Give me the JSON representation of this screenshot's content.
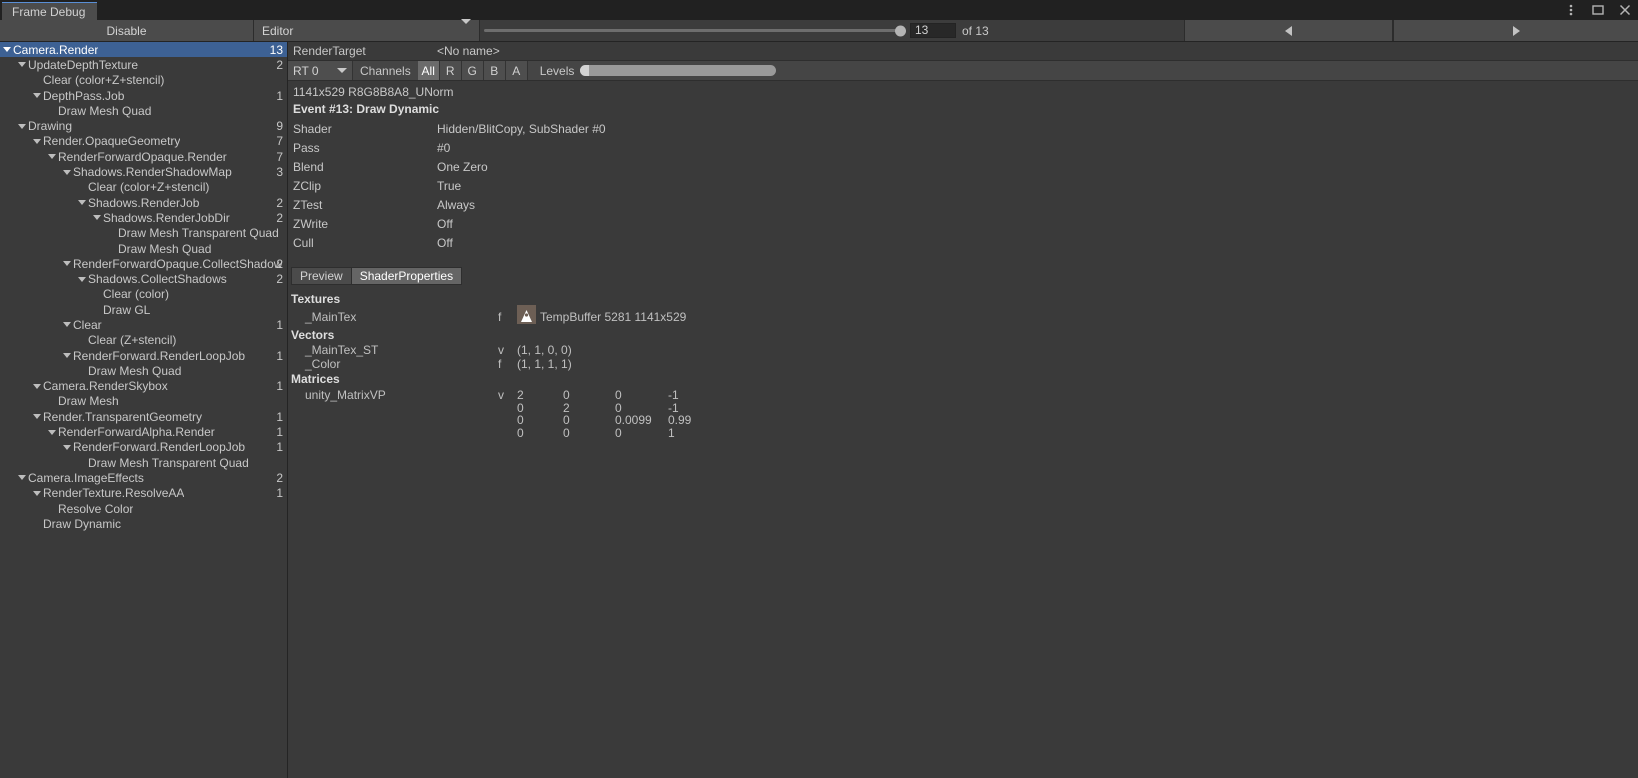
{
  "window": {
    "tab_title": "Frame Debug",
    "controls": [
      {
        "name": "kebab-menu",
        "icon": "kebab-icon"
      },
      {
        "name": "maximize",
        "icon": "maximize-icon"
      },
      {
        "name": "close",
        "icon": "close-icon"
      }
    ]
  },
  "toolbar": {
    "disable_label": "Disable",
    "target_dropdown_value": "Editor",
    "event_index_value": "13",
    "event_total_label": "of 13",
    "prev_icon": "triangle-left-icon",
    "next_icon": "triangle-right-icon"
  },
  "tree": {
    "rows": [
      {
        "label": "Camera.Render",
        "count": "13",
        "depth": 0,
        "foldout": true,
        "selected": true
      },
      {
        "label": "UpdateDepthTexture",
        "count": "2",
        "depth": 1,
        "foldout": true,
        "selected": false
      },
      {
        "label": "Clear (color+Z+stencil)",
        "count": "",
        "depth": 2,
        "foldout": false,
        "selected": false
      },
      {
        "label": "DepthPass.Job",
        "count": "1",
        "depth": 2,
        "foldout": true,
        "selected": false
      },
      {
        "label": "Draw Mesh Quad",
        "count": "",
        "depth": 3,
        "foldout": false,
        "selected": false
      },
      {
        "label": "Drawing",
        "count": "9",
        "depth": 1,
        "foldout": true,
        "selected": false
      },
      {
        "label": "Render.OpaqueGeometry",
        "count": "7",
        "depth": 2,
        "foldout": true,
        "selected": false
      },
      {
        "label": "RenderForwardOpaque.Render",
        "count": "7",
        "depth": 3,
        "foldout": true,
        "selected": false
      },
      {
        "label": "Shadows.RenderShadowMap",
        "count": "3",
        "depth": 4,
        "foldout": true,
        "selected": false
      },
      {
        "label": "Clear (color+Z+stencil)",
        "count": "",
        "depth": 5,
        "foldout": false,
        "selected": false
      },
      {
        "label": "Shadows.RenderJob",
        "count": "2",
        "depth": 5,
        "foldout": true,
        "selected": false
      },
      {
        "label": "Shadows.RenderJobDir",
        "count": "2",
        "depth": 6,
        "foldout": true,
        "selected": false
      },
      {
        "label": "Draw Mesh Transparent Quad",
        "count": "",
        "depth": 7,
        "foldout": false,
        "selected": false
      },
      {
        "label": "Draw Mesh Quad",
        "count": "",
        "depth": 7,
        "foldout": false,
        "selected": false
      },
      {
        "label": "RenderForwardOpaque.CollectShadow",
        "count": "2",
        "depth": 4,
        "foldout": true,
        "selected": false
      },
      {
        "label": "Shadows.CollectShadows",
        "count": "2",
        "depth": 5,
        "foldout": true,
        "selected": false
      },
      {
        "label": "Clear (color)",
        "count": "",
        "depth": 6,
        "foldout": false,
        "selected": false
      },
      {
        "label": "Draw GL",
        "count": "",
        "depth": 6,
        "foldout": false,
        "selected": false
      },
      {
        "label": "Clear",
        "count": "1",
        "depth": 4,
        "foldout": true,
        "selected": false
      },
      {
        "label": "Clear (Z+stencil)",
        "count": "",
        "depth": 5,
        "foldout": false,
        "selected": false
      },
      {
        "label": "RenderForward.RenderLoopJob",
        "count": "1",
        "depth": 4,
        "foldout": true,
        "selected": false
      },
      {
        "label": "Draw Mesh Quad",
        "count": "",
        "depth": 5,
        "foldout": false,
        "selected": false
      },
      {
        "label": "Camera.RenderSkybox",
        "count": "1",
        "depth": 2,
        "foldout": true,
        "selected": false
      },
      {
        "label": "Draw Mesh",
        "count": "",
        "depth": 3,
        "foldout": false,
        "selected": false
      },
      {
        "label": "Render.TransparentGeometry",
        "count": "1",
        "depth": 2,
        "foldout": true,
        "selected": false
      },
      {
        "label": "RenderForwardAlpha.Render",
        "count": "1",
        "depth": 3,
        "foldout": true,
        "selected": false
      },
      {
        "label": "RenderForward.RenderLoopJob",
        "count": "1",
        "depth": 4,
        "foldout": true,
        "selected": false
      },
      {
        "label": "Draw Mesh Transparent Quad",
        "count": "",
        "depth": 5,
        "foldout": false,
        "selected": false
      },
      {
        "label": "Camera.ImageEffects",
        "count": "2",
        "depth": 1,
        "foldout": true,
        "selected": false
      },
      {
        "label": "RenderTexture.ResolveAA",
        "count": "1",
        "depth": 2,
        "foldout": true,
        "selected": false
      },
      {
        "label": "Resolve Color",
        "count": "",
        "depth": 3,
        "foldout": false,
        "selected": false
      },
      {
        "label": "Draw Dynamic",
        "count": "",
        "depth": 2,
        "foldout": false,
        "selected": false
      }
    ]
  },
  "detail": {
    "render_target_label": "RenderTarget",
    "render_target_name": "<No name>",
    "rt_select_value": "RT 0",
    "channels_label": "Channels",
    "channel_buttons": [
      {
        "label": "All",
        "active": true
      },
      {
        "label": "R",
        "active": false
      },
      {
        "label": "G",
        "active": false
      },
      {
        "label": "B",
        "active": false
      },
      {
        "label": "A",
        "active": false
      }
    ],
    "levels_label": "Levels",
    "format_text": "1141x529 R8G8B8A8_UNorm",
    "event_title": "Event #13: Draw Dynamic",
    "properties": [
      {
        "name": "Shader",
        "value": "Hidden/BlitCopy, SubShader #0"
      },
      {
        "name": "Pass",
        "value": "#0"
      },
      {
        "name": "Blend",
        "value": "One Zero"
      },
      {
        "name": "ZClip",
        "value": "True"
      },
      {
        "name": "ZTest",
        "value": "Always"
      },
      {
        "name": "ZWrite",
        "value": "Off"
      },
      {
        "name": "Cull",
        "value": "Off"
      }
    ],
    "tabs": [
      {
        "label": "Preview",
        "active": false
      },
      {
        "label": "ShaderProperties",
        "active": true
      }
    ],
    "textures_title": "Textures",
    "textures": [
      {
        "name": "_MainTex",
        "flag": "f",
        "value": "TempBuffer 5281 1141x529",
        "thumb": "texture-thumbnail-icon"
      }
    ],
    "vectors_title": "Vectors",
    "vectors": [
      {
        "name": "_MainTex_ST",
        "flag": "v",
        "value": "(1, 1, 0, 0)"
      },
      {
        "name": "_Color",
        "flag": "f",
        "value": "(1, 1, 1, 1)"
      }
    ],
    "matrices_title": "Matrices",
    "matrices": [
      {
        "name": "unity_MatrixVP",
        "flag": "v",
        "rows": [
          [
            "2",
            "0",
            "0",
            "-1"
          ],
          [
            "0",
            "2",
            "0",
            "-1"
          ],
          [
            "0",
            "0",
            "0.0099",
            "0.99"
          ],
          [
            "0",
            "0",
            "0",
            "1"
          ]
        ]
      }
    ]
  },
  "colors": {
    "selection_blue": "#3d6194",
    "panel_bg": "#3a3a3a",
    "toolbar_bg": "#4b4b4b",
    "titlebar_bg": "#212121"
  }
}
